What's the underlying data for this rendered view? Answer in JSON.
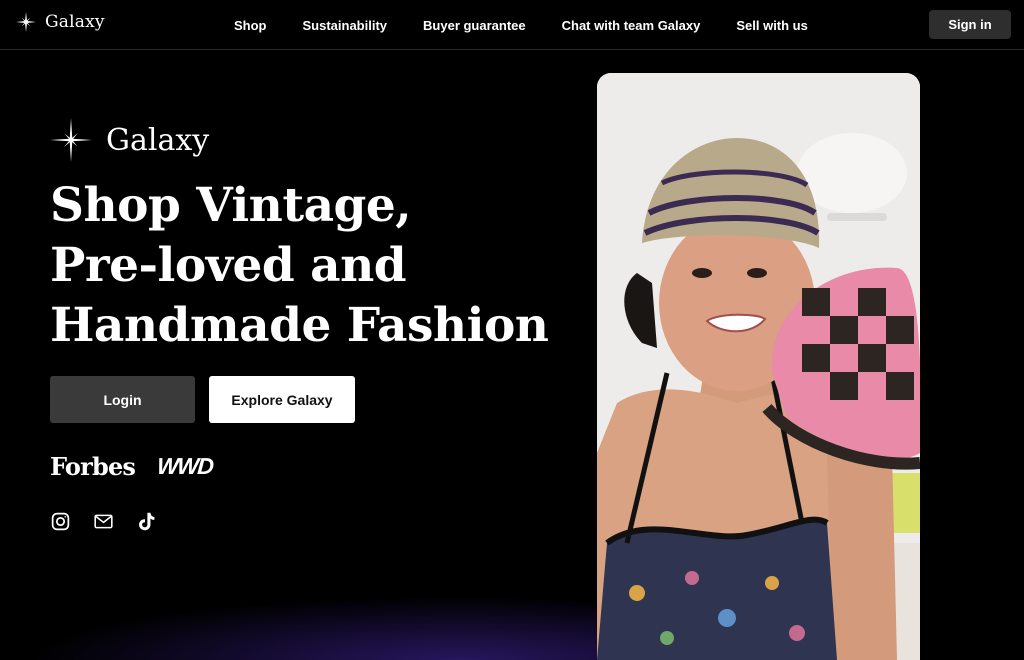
{
  "header": {
    "brand": "Galaxy",
    "nav": [
      "Shop",
      "Sustainability",
      "Buyer guarantee",
      "Chat with team Galaxy",
      "Sell with us"
    ],
    "sign_in": "Sign in"
  },
  "hero": {
    "brand": "Galaxy",
    "headline": [
      "Shop Vintage,",
      "Pre-loved and",
      "Handmade Fashion"
    ],
    "login_label": "Login",
    "explore_label": "Explore Galaxy",
    "press": [
      "Forbes",
      "WWD"
    ],
    "social_icons": [
      "instagram-icon",
      "mail-icon",
      "tiktok-icon"
    ]
  },
  "colors": {
    "background": "#000000",
    "login_button": "#3a3a3a",
    "explore_button": "#ffffff",
    "sign_in_button": "#2e2e2e",
    "glow": "#4628aa"
  }
}
